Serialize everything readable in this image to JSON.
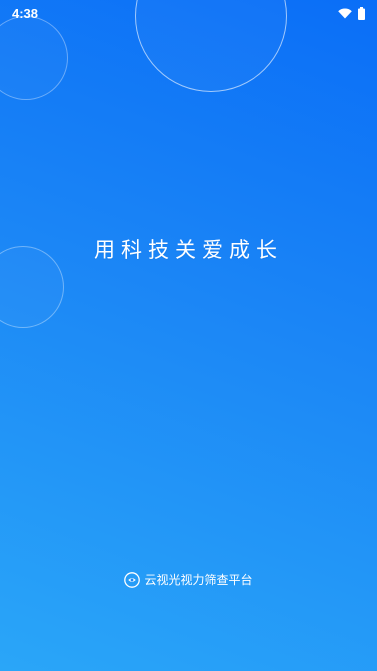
{
  "status_bar": {
    "time": "4:38",
    "icons": [
      "wifi-icon",
      "battery-icon"
    ]
  },
  "splash": {
    "slogan": "用科技关爱成长",
    "brand_name": "云视光视力筛查平台",
    "brand_icon": "eye-logo-icon"
  },
  "colors": {
    "gradient_top": "#0a6ef7",
    "gradient_bottom": "#2aa6f8",
    "text": "#ffffff"
  }
}
